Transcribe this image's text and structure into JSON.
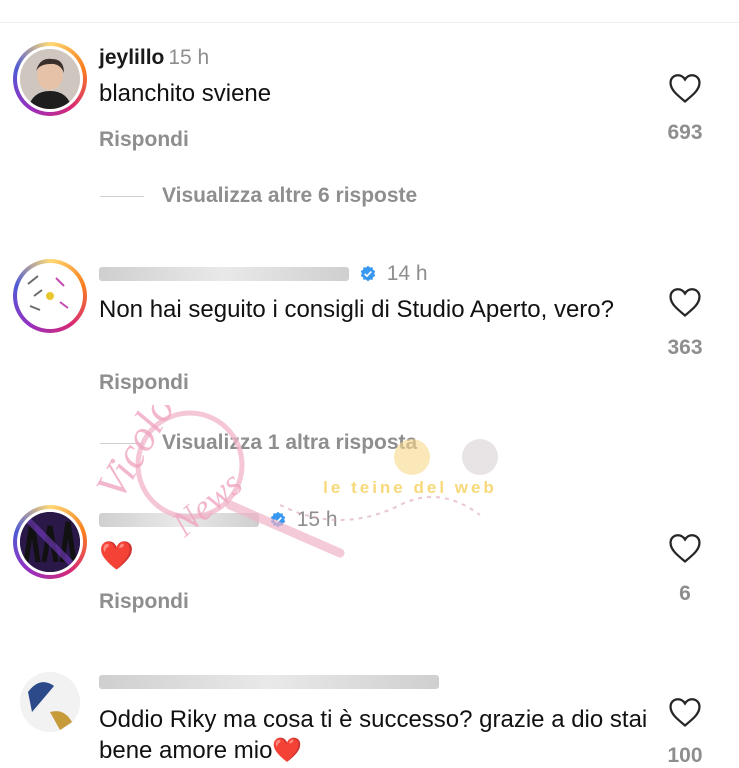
{
  "comments": [
    {
      "username": "jeylillo",
      "time": "15 h",
      "text": "blanchito sviene",
      "reply_label": "Rispondi",
      "likes": "693",
      "more_replies": "Visualizza altre 6 risposte",
      "verified": false
    },
    {
      "username": "",
      "time": "14 h",
      "text": "Non hai seguito i consigli di Studio Aperto, vero?",
      "reply_label": "Rispondi",
      "likes": "363",
      "more_replies": "Visualizza 1 altra risposta",
      "verified": true
    },
    {
      "username": "",
      "time": "15 h",
      "text": "❤️",
      "reply_label": "Rispondi",
      "likes": "6",
      "verified": true
    },
    {
      "username": "",
      "time": "",
      "text": "Oddio Riky ma cosa ti è successo? grazie a dio stai bene amore mio❤️",
      "likes": "100",
      "verified": false
    }
  ],
  "watermark": {
    "logo_text": "Vicolo delle News",
    "tagline": "le teine del web"
  },
  "colors": {
    "muted": "#8e8e8e",
    "verified": "#3897f0",
    "heart_red": "#e0112b"
  },
  "icons": [
    "heart-icon",
    "verified-badge-icon"
  ]
}
